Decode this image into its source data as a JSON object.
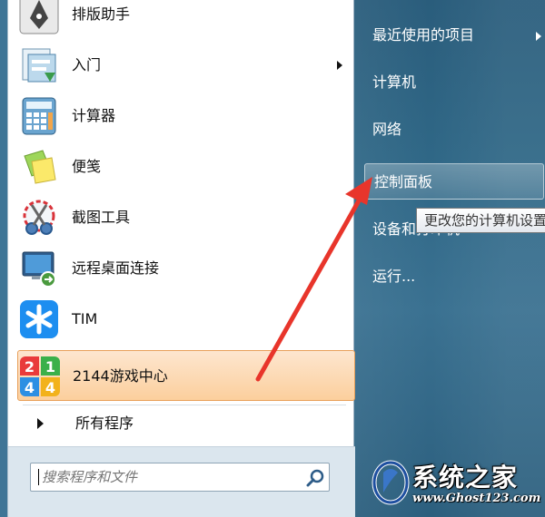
{
  "start_menu": {
    "programs": [
      {
        "label": "排版助手",
        "icon": "pen-nib-icon"
      },
      {
        "label": "入门",
        "icon": "getting-started-icon",
        "has_submenu": true
      },
      {
        "label": "计算器",
        "icon": "calculator-icon"
      },
      {
        "label": "便笺",
        "icon": "sticky-notes-icon"
      },
      {
        "label": "截图工具",
        "icon": "scissors-icon"
      },
      {
        "label": "远程桌面连接",
        "icon": "remote-desktop-icon"
      },
      {
        "label": "TIM",
        "icon": "tim-star-icon"
      },
      {
        "label": "2144游戏中心",
        "icon": "game-center-icon",
        "selected": true
      }
    ],
    "all_programs_label": "所有程序",
    "search_placeholder": "搜索程序和文件"
  },
  "right_pane": {
    "items": [
      {
        "label": "最近使用的项目",
        "has_submenu": true
      },
      {
        "label": "计算机"
      },
      {
        "label": "网络"
      },
      {
        "label": "控制面板",
        "hovered": true
      },
      {
        "label": "设备和打印机"
      },
      {
        "label": "运行..."
      }
    ]
  },
  "tooltip": {
    "text": "更改您的计算机设置"
  },
  "watermark": {
    "title": "系统之家",
    "url": "www.Ghost123.com"
  },
  "colors": {
    "selected_bg": "#fccf9d",
    "arrow": "#e8352b",
    "right_pane": "#2f6786"
  }
}
